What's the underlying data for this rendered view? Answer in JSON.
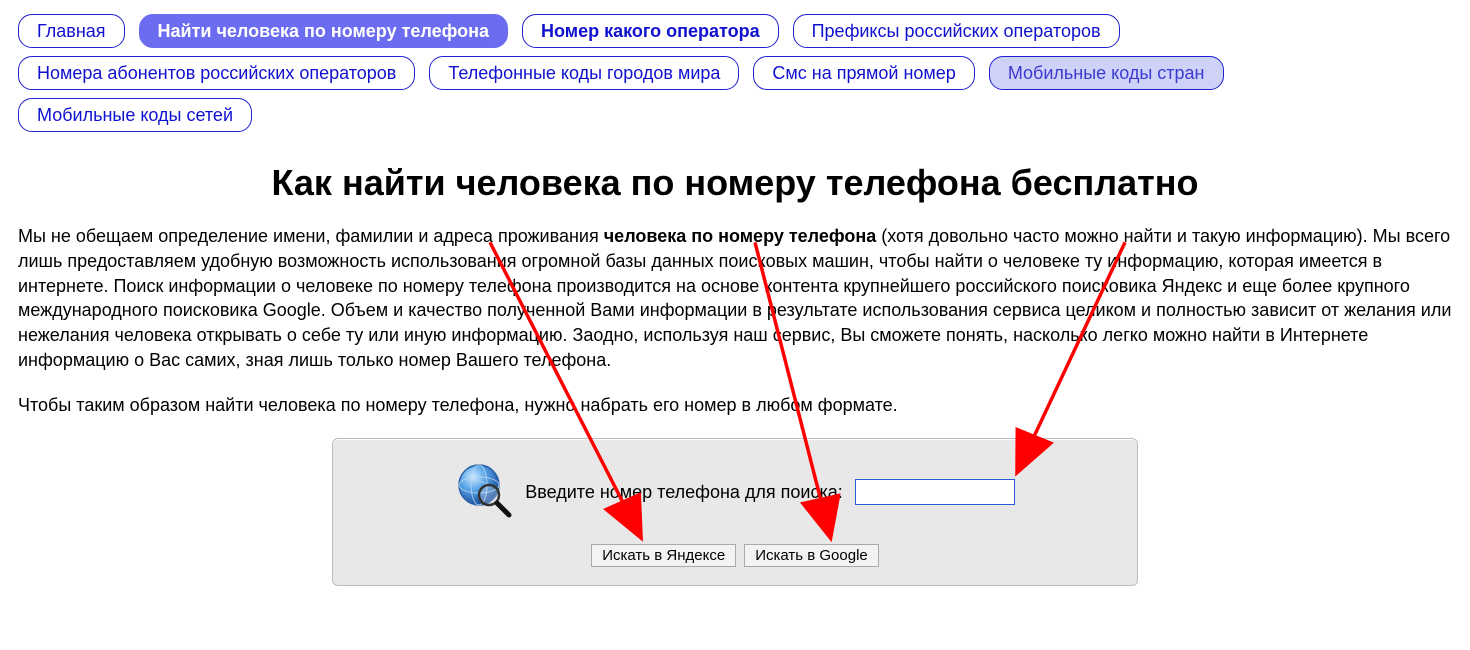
{
  "nav": {
    "items": [
      {
        "label": "Главная",
        "cls": ""
      },
      {
        "label": "Найти человека по номеру телефона",
        "cls": "active"
      },
      {
        "label": "Номер какого оператора",
        "cls": "bold"
      },
      {
        "label": "Префиксы российских операторов",
        "cls": ""
      },
      {
        "label": "Номера абонентов российских операторов",
        "cls": ""
      },
      {
        "label": "Телефонные коды городов мира",
        "cls": ""
      },
      {
        "label": "Смс на прямой номер",
        "cls": ""
      },
      {
        "label": "Мобильные коды стран",
        "cls": "dim"
      },
      {
        "label": "Мобильные коды сетей",
        "cls": ""
      }
    ]
  },
  "heading": "Как найти человека по номеру телефона бесплатно",
  "paragraph1_before": "Мы не обещаем определение имени, фамилии и адреса проживания ",
  "paragraph1_strong": "человека по номеру телефона",
  "paragraph1_after": " (хотя довольно часто можно найти и такую информацию). Мы всего лишь предоставляем удобную возможность использования огромной базы данных поисковых машин, чтобы найти о человеке ту информацию, которая имеется в интернете. Поиск информации о человеке по номеру телефона производится на основе контента крупнейшего российского поисковика Яндекс и еще более крупного международного поисковика Google. Объем и качество полученной Вами информации в результате использования сервиса целиком и полностью зависит от желания или нежелания человека открывать о себе ту или иную информацию. Заодно, используя наш сервис, Вы сможете понять, насколько легко можно найти в Интернете информацию о Вас самих, зная лишь только номер Вашего телефона.",
  "paragraph2": "Чтобы таким образом найти человека по номеру телефона, нужно набрать его номер в любом формате.",
  "search": {
    "label": "Введите номер телефона для поиска:",
    "value": "",
    "btn_yandex": "Искать в Яндексе",
    "btn_google": "Искать в Google"
  }
}
